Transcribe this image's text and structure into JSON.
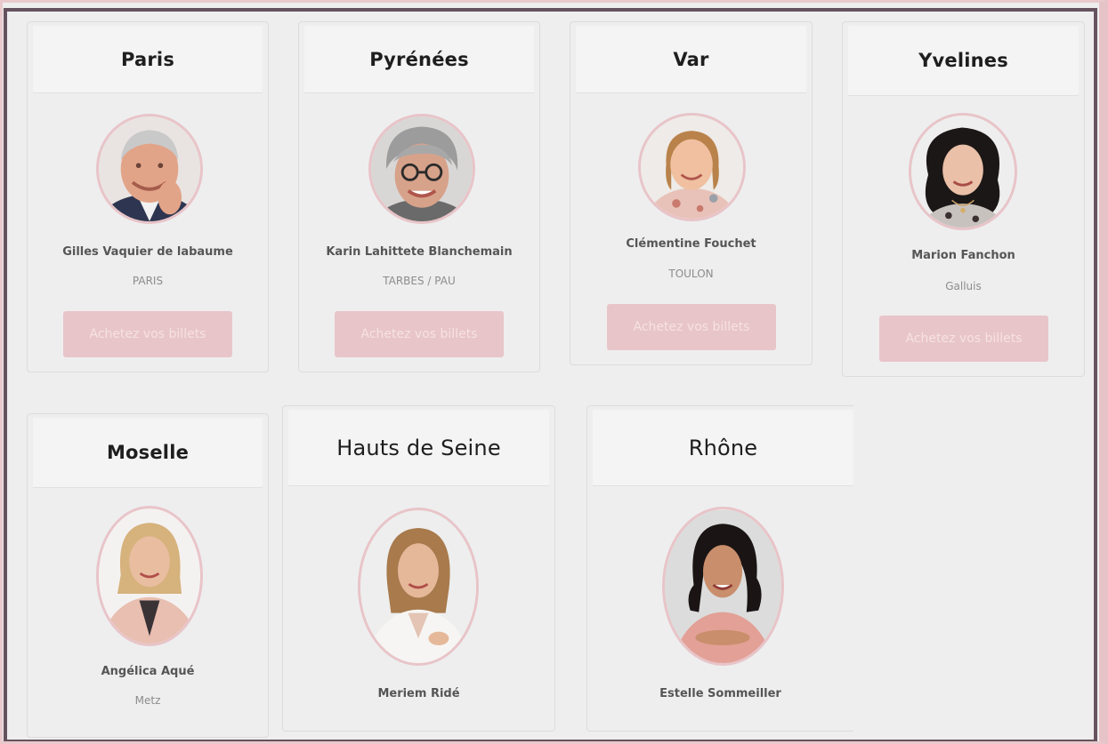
{
  "cards": [
    {
      "region": "Paris",
      "name": "Gilles Vaquier de labaume",
      "city": "PARIS",
      "button": "Achetez vos billets"
    },
    {
      "region": "Pyrénées",
      "name": "Karin Lahittete Blanchemain",
      "city": "TARBES / PAU",
      "button": "Achetez vos billets"
    },
    {
      "region": "Var",
      "name": "Clémentine Fouchet",
      "city": "TOULON",
      "button": "Achetez vos billets"
    },
    {
      "region": "Yvelines",
      "name": "Marion Fanchon",
      "city": "Galluis",
      "button": "Achetez vos billets"
    },
    {
      "region": "Moselle",
      "name": "Angélica Aqué",
      "city": "Metz"
    },
    {
      "region": "Hauts de Seine",
      "name": "Meriem Ridé"
    },
    {
      "region": "Rhône",
      "name": "Estelle Sommeiller"
    }
  ],
  "colors": {
    "accent_pink": "#e8c5c9",
    "frame_dark": "#66525e",
    "background": "#eeeeef"
  }
}
